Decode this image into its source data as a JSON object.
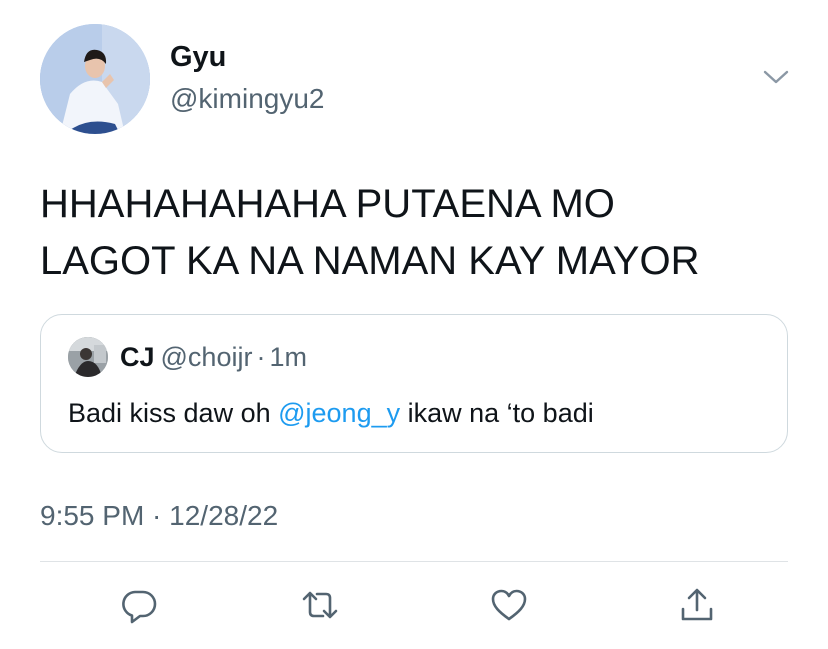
{
  "author": {
    "display_name": "Gyu",
    "handle": "@kimingyu2"
  },
  "tweet": {
    "text": "HHAHAHAHAHA PUTAENA MO\nLAGOT KA NA NAMAN KAY MAYOR",
    "timestamp": "9:55 PM · 12/28/22"
  },
  "quoted_tweet": {
    "author_name": "CJ",
    "author_handle": "@choijr",
    "separator": "·",
    "time": "1m",
    "text_before": "Badi kiss daw oh ",
    "mention": "@jeong_y",
    "text_after": " ikaw na ‘to badi"
  },
  "actions": [
    {
      "icon": "reply-icon"
    },
    {
      "icon": "retweet-icon"
    },
    {
      "icon": "like-icon"
    },
    {
      "icon": "share-icon"
    }
  ],
  "colors": {
    "text": "#0f1419",
    "secondary": "#536471",
    "link": "#1d9bf0",
    "border": "#cfd9de"
  }
}
